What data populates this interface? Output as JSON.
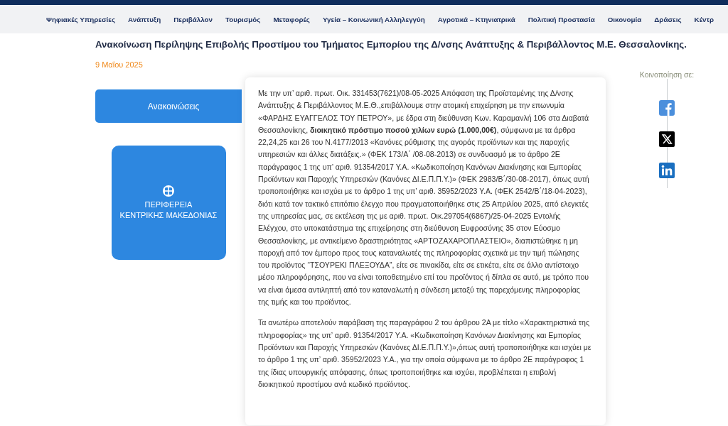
{
  "nav": {
    "items": [
      {
        "label": "Ψηφιακές Υπηρεσίες"
      },
      {
        "label": "Ανάπτυξη"
      },
      {
        "label": "Περιβάλλον"
      },
      {
        "label": "Τουρισμός"
      },
      {
        "label": "Μεταφορές"
      },
      {
        "label": "Υγεία – Κοινωνική Αλληλεγγύη"
      },
      {
        "label": "Αγροτικά – Κτηνιατρικά"
      },
      {
        "label": "Πολιτική Προστασία"
      },
      {
        "label": "Οικονομία"
      },
      {
        "label": "Δράσεις"
      },
      {
        "label": "Κέντρ"
      }
    ]
  },
  "article": {
    "title": "Ανακοίνωση Περίληψης Επιβολής Προστίμου του Τμήματος Εμπορίου της Δ/νσης Ανάπτυξης & Περιβάλλοντος Μ.Ε. Θεσσαλονίκης.",
    "date": "9 Μαΐου 2025",
    "paragraphs": [
      "Με την υπ’ αριθ. πρωτ. Οικ. 331453(7621)/08-05-2025 Απόφαση της Προϊσταμένης της Δ/νσης Ανάπτυξης & Περιβάλλοντος Μ.Ε.Θ.,επιβάλλουμε στην ατομική επιχείρηση με την επωνυμία «ΦΑΡΔΗΣ ΕΥΑΓΓΕΛΟΣ ΤΟΥ ΠΕΤΡΟΥ», με έδρα στη διεύθυνση Κων. Καραμανλή 106 στα Διαβατά Θεσσαλονίκης, **διοικητικό πρόστιμο ποσού χιλίων ευρώ (1.000,00€)**, σύμφωνα με τα άρθρα 22,24,25 και 26 του Ν.4177/2013 «Κανόνες ρύθμισης της αγοράς προϊόντων και της παροχής υπηρεσιών και άλλες διατάξεις.» (ΦΕΚ 173/Α΄ /08-08-2013) σε συνδυασμό με το άρθρο 2Ε παράγραφος 1 της υπ’ αριθ. 91354/2017 Υ.Α. «Κωδικοποίηση Κανόνων Διακίνησης και Εμπορίας Προϊόντων και Παροχής Υπηρεσιών (Κανόνες ΔΙ.Ε.Π.Π.Υ.)» (ΦΕΚ 2983/Β΄/30-08-2017), όπως αυτή τροποποιήθηκε και ισχύει με το άρθρο 1 της υπ’ αριθ. 35952/2023 Υ.Α. (ΦΕΚ 2542/Β΄/18-04-2023), διότι κατά τον τακτικό επιτόπιο έλεγχο που πραγματοποιήθηκε στις 25 Απριλίου 2025, από ελεγκτές της υπηρεσίας μας, σε εκτέλεση της με αριθ. πρωτ. Οικ.297054(6867)/25-04-2025 Εντολής Ελέγχου, στο υποκατάστημα της επιχείρησης στη διεύθυνση Ευφροσύνης 35 στον Εύοσμο Θεσσαλονίκης, με αντικείμενο δραστηριότητας «ΑΡΤΟΖΑΧΑΡΟΠΛΑΣΤΕΙΟ», διαπιστώθηκε η μη παροχή από τον έμπορο προς τους καταναλωτές της πληροφορίας σχετικά με την τιμή πώλησης του προϊόντος “ΤΣΟΥΡΕΚΙ ΠΛΕΞΟΥΔΑ”, είτε σε πινακίδα, είτε σε ετικέτα, είτε σε άλλο αντίστοιχο μέσο πληροφόρησης, που να είναι τοποθετημένο επί του προϊόντος ή δίπλα σε αυτό, με τρόπο που να είναι άμεσα αντιληπτή από τον καταναλωτή η σύνδεση μεταξύ της παρεχόμενης πληροφορίας της τιμής και του προϊόντος.",
      "Τα ανωτέρω αποτελούν παράβαση της παραγράφου 2 του άρθρου 2Α με τίτλο «Χαρακτηριστικά της πληροφορίας» της υπ’ αριθ. 91354/2017 Υ.Α. «Κωδικοποίηση Κανόνων Διακίνησης και Εμπορίας Προϊόντων και Παροχής Υπηρεσιών (Κανόνες ΔΙ.Ε.Π.Π.Υ.)»,όπως αυτή τροποποιήθηκε και ισχύει με το άρθρο 1 της υπ’ αριθ. 35952/2023 Υ.Α., για την οποία σύμφωνα με το άρθρο 2Ε παράγραφος 1 της ίδιας υπουργικής απόφασης, όπως τροποποιήθηκε και ισχύει, προβλέπεται η επιβολή διοικητικού προστίμου ανά κωδικό προϊόντος."
    ]
  },
  "sidebar": {
    "button": "Ανακοινώσεις",
    "logo_lines": [
      "ΠΕΡΙΦΕΡΕΙΑ",
      "ΚΕΝΤΡΙΚΗΣ ΜΑΚΕΔΟΝΙΑΣ"
    ]
  },
  "share": {
    "label": "Κοινοποίηση σε:",
    "networks": [
      {
        "kind": "facebook"
      },
      {
        "kind": "x"
      },
      {
        "kind": "linkedin"
      }
    ]
  }
}
